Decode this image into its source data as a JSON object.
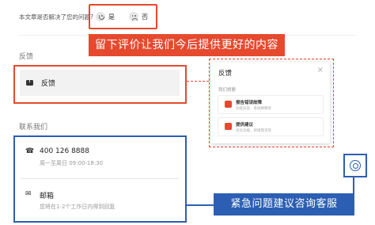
{
  "helpful": {
    "question": "本文章是否解决了您的问题?",
    "yes_label": "是",
    "no_label": "否"
  },
  "annotations": {
    "top_callout": "留下评价让我们今后提供更好的内容",
    "bottom_callout": "紧急问题建议咨询客服"
  },
  "feedback": {
    "section_title": "反馈",
    "button_label": "反馈"
  },
  "popup": {
    "title": "反馈",
    "close": "×",
    "subtitle": "我们想要",
    "items": [
      {
        "title": "报告错误故障",
        "desc": "功能异常、系统故障等"
      },
      {
        "title": "提供建议",
        "desc": "优化功能、新增需求等"
      }
    ]
  },
  "contact": {
    "section_title": "联系我们",
    "phone": {
      "number": "400 126 8888",
      "hours": "周一至周日 09:00-18:30"
    },
    "email": {
      "label": "邮箱",
      "note": "您将在1-2个工作日内得到回复"
    }
  },
  "colors": {
    "red": "#e64a2e",
    "blue": "#2c5fb3"
  }
}
